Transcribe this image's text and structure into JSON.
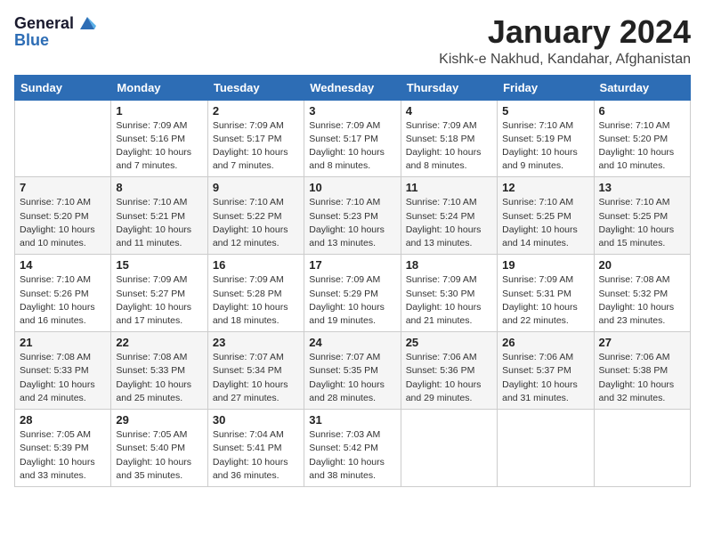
{
  "logo": {
    "line1": "General",
    "line2": "Blue"
  },
  "title": "January 2024",
  "subtitle": "Kishk-e Nakhud, Kandahar, Afghanistan",
  "days_of_week": [
    "Sunday",
    "Monday",
    "Tuesday",
    "Wednesday",
    "Thursday",
    "Friday",
    "Saturday"
  ],
  "weeks": [
    [
      {
        "num": "",
        "info": ""
      },
      {
        "num": "1",
        "info": "Sunrise: 7:09 AM\nSunset: 5:16 PM\nDaylight: 10 hours\nand 7 minutes."
      },
      {
        "num": "2",
        "info": "Sunrise: 7:09 AM\nSunset: 5:17 PM\nDaylight: 10 hours\nand 7 minutes."
      },
      {
        "num": "3",
        "info": "Sunrise: 7:09 AM\nSunset: 5:17 PM\nDaylight: 10 hours\nand 8 minutes."
      },
      {
        "num": "4",
        "info": "Sunrise: 7:09 AM\nSunset: 5:18 PM\nDaylight: 10 hours\nand 8 minutes."
      },
      {
        "num": "5",
        "info": "Sunrise: 7:10 AM\nSunset: 5:19 PM\nDaylight: 10 hours\nand 9 minutes."
      },
      {
        "num": "6",
        "info": "Sunrise: 7:10 AM\nSunset: 5:20 PM\nDaylight: 10 hours\nand 10 minutes."
      }
    ],
    [
      {
        "num": "7",
        "info": "Sunrise: 7:10 AM\nSunset: 5:20 PM\nDaylight: 10 hours\nand 10 minutes."
      },
      {
        "num": "8",
        "info": "Sunrise: 7:10 AM\nSunset: 5:21 PM\nDaylight: 10 hours\nand 11 minutes."
      },
      {
        "num": "9",
        "info": "Sunrise: 7:10 AM\nSunset: 5:22 PM\nDaylight: 10 hours\nand 12 minutes."
      },
      {
        "num": "10",
        "info": "Sunrise: 7:10 AM\nSunset: 5:23 PM\nDaylight: 10 hours\nand 13 minutes."
      },
      {
        "num": "11",
        "info": "Sunrise: 7:10 AM\nSunset: 5:24 PM\nDaylight: 10 hours\nand 13 minutes."
      },
      {
        "num": "12",
        "info": "Sunrise: 7:10 AM\nSunset: 5:25 PM\nDaylight: 10 hours\nand 14 minutes."
      },
      {
        "num": "13",
        "info": "Sunrise: 7:10 AM\nSunset: 5:25 PM\nDaylight: 10 hours\nand 15 minutes."
      }
    ],
    [
      {
        "num": "14",
        "info": "Sunrise: 7:10 AM\nSunset: 5:26 PM\nDaylight: 10 hours\nand 16 minutes."
      },
      {
        "num": "15",
        "info": "Sunrise: 7:09 AM\nSunset: 5:27 PM\nDaylight: 10 hours\nand 17 minutes."
      },
      {
        "num": "16",
        "info": "Sunrise: 7:09 AM\nSunset: 5:28 PM\nDaylight: 10 hours\nand 18 minutes."
      },
      {
        "num": "17",
        "info": "Sunrise: 7:09 AM\nSunset: 5:29 PM\nDaylight: 10 hours\nand 19 minutes."
      },
      {
        "num": "18",
        "info": "Sunrise: 7:09 AM\nSunset: 5:30 PM\nDaylight: 10 hours\nand 21 minutes."
      },
      {
        "num": "19",
        "info": "Sunrise: 7:09 AM\nSunset: 5:31 PM\nDaylight: 10 hours\nand 22 minutes."
      },
      {
        "num": "20",
        "info": "Sunrise: 7:08 AM\nSunset: 5:32 PM\nDaylight: 10 hours\nand 23 minutes."
      }
    ],
    [
      {
        "num": "21",
        "info": "Sunrise: 7:08 AM\nSunset: 5:33 PM\nDaylight: 10 hours\nand 24 minutes."
      },
      {
        "num": "22",
        "info": "Sunrise: 7:08 AM\nSunset: 5:33 PM\nDaylight: 10 hours\nand 25 minutes."
      },
      {
        "num": "23",
        "info": "Sunrise: 7:07 AM\nSunset: 5:34 PM\nDaylight: 10 hours\nand 27 minutes."
      },
      {
        "num": "24",
        "info": "Sunrise: 7:07 AM\nSunset: 5:35 PM\nDaylight: 10 hours\nand 28 minutes."
      },
      {
        "num": "25",
        "info": "Sunrise: 7:06 AM\nSunset: 5:36 PM\nDaylight: 10 hours\nand 29 minutes."
      },
      {
        "num": "26",
        "info": "Sunrise: 7:06 AM\nSunset: 5:37 PM\nDaylight: 10 hours\nand 31 minutes."
      },
      {
        "num": "27",
        "info": "Sunrise: 7:06 AM\nSunset: 5:38 PM\nDaylight: 10 hours\nand 32 minutes."
      }
    ],
    [
      {
        "num": "28",
        "info": "Sunrise: 7:05 AM\nSunset: 5:39 PM\nDaylight: 10 hours\nand 33 minutes."
      },
      {
        "num": "29",
        "info": "Sunrise: 7:05 AM\nSunset: 5:40 PM\nDaylight: 10 hours\nand 35 minutes."
      },
      {
        "num": "30",
        "info": "Sunrise: 7:04 AM\nSunset: 5:41 PM\nDaylight: 10 hours\nand 36 minutes."
      },
      {
        "num": "31",
        "info": "Sunrise: 7:03 AM\nSunset: 5:42 PM\nDaylight: 10 hours\nand 38 minutes."
      },
      {
        "num": "",
        "info": ""
      },
      {
        "num": "",
        "info": ""
      },
      {
        "num": "",
        "info": ""
      }
    ]
  ]
}
